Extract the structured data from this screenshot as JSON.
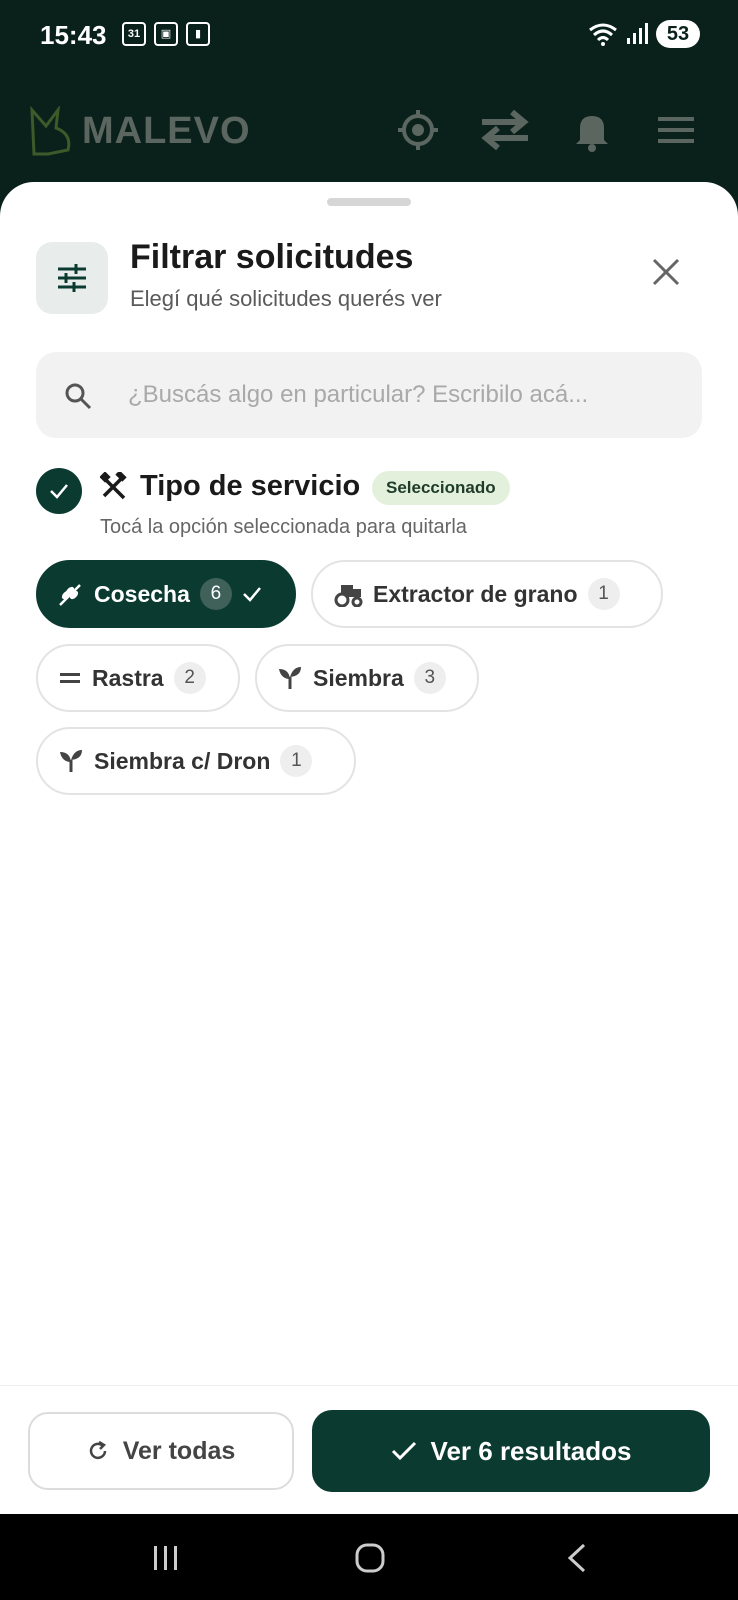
{
  "status_bar": {
    "time": "15:43",
    "calendar_day": "31",
    "battery": "53"
  },
  "app": {
    "brand": "MALEVO"
  },
  "sheet": {
    "title": "Filtrar solicitudes",
    "subtitle": "Elegí qué solicitudes querés ver",
    "search_placeholder": "¿Buscás algo en particular? Escribilo acá...",
    "section": {
      "title": "Tipo de servicio",
      "badge": "Seleccionado",
      "hint": "Tocá la opción seleccionada para quitarla"
    },
    "chips": [
      {
        "label": "Cosecha",
        "count": "6",
        "icon": "wheat-icon",
        "selected": true
      },
      {
        "label": "Extractor de grano",
        "count": "1",
        "icon": "tractor-icon",
        "selected": false
      },
      {
        "label": "Rastra",
        "count": "2",
        "icon": "equals-icon",
        "selected": false
      },
      {
        "label": "Siembra",
        "count": "3",
        "icon": "sprout-icon",
        "selected": false
      },
      {
        "label": "Siembra c/ Dron",
        "count": "1",
        "icon": "sprout-icon",
        "selected": false
      }
    ]
  },
  "footer": {
    "reset_label": "Ver todas",
    "apply_label": "Ver 6 resultados"
  },
  "colors": {
    "primary": "#0b3a30",
    "badge_bg": "#e3f1dc",
    "header_bg": "#0a211b"
  }
}
